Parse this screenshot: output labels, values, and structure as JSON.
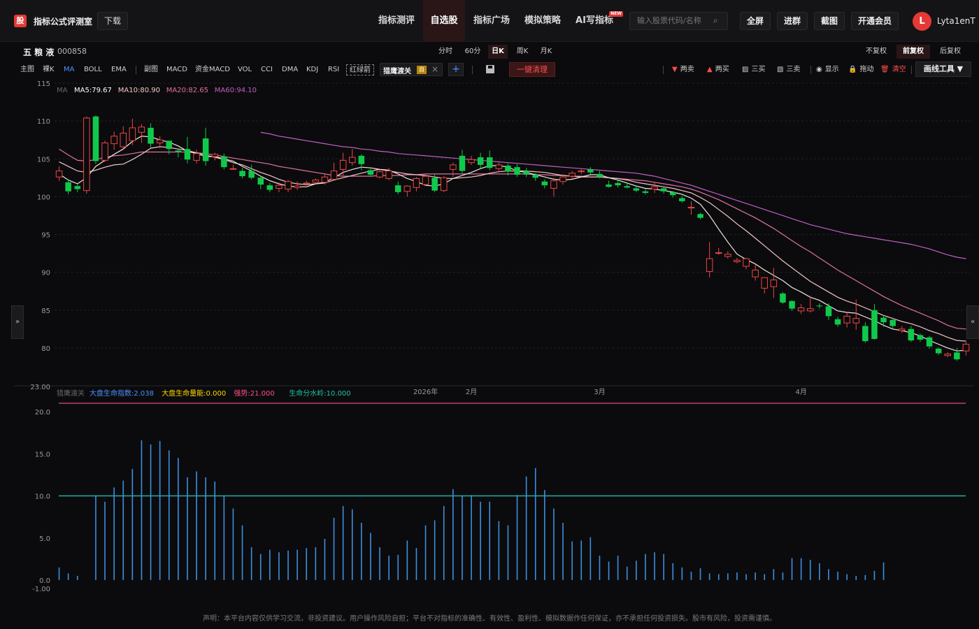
{
  "app": {
    "logo_glyph": "股",
    "brand": "指标公式评测室",
    "download_label": "下载"
  },
  "nav": {
    "items": [
      {
        "label": "指标测评",
        "active": false
      },
      {
        "label": "自选股",
        "active": true
      },
      {
        "label": "指标广场",
        "active": false
      },
      {
        "label": "模拟策略",
        "active": false
      },
      {
        "label": "AI写指标",
        "active": false,
        "badge": "NEW"
      }
    ]
  },
  "search": {
    "placeholder": "输入股票代码/名称",
    "icon": "search-icon"
  },
  "top_buttons": [
    "全屏",
    "进群",
    "截图",
    "开通会员"
  ],
  "user": {
    "avatar_letter": "L",
    "name": "Lyta1enT"
  },
  "stock": {
    "name": "五 粮 液",
    "code": "000858"
  },
  "periods": [
    {
      "label": "分时",
      "active": false
    },
    {
      "label": "60分",
      "active": false
    },
    {
      "label": "日K",
      "active": true
    },
    {
      "label": "周K",
      "active": false
    },
    {
      "label": "月K",
      "active": false
    }
  ],
  "rights": [
    {
      "label": "不复权",
      "active": false
    },
    {
      "label": "前复权",
      "active": true
    },
    {
      "label": "后复权",
      "active": false
    }
  ],
  "indicators_main": [
    "主图",
    "裸K",
    "MA",
    "BOLL",
    "EMA"
  ],
  "indicators_sub": [
    "副图",
    "MACD",
    "资金MACD",
    "VOL",
    "CCI",
    "DMA",
    "KDJ",
    "RSI",
    "红绿箭"
  ],
  "custom_indicator": {
    "label": "猎鹰渡关",
    "tag": "自"
  },
  "clear_label": "一键清理",
  "draw_tools": [
    {
      "icon": "▼",
      "label": "两卖",
      "color": "#ff4d4f"
    },
    {
      "icon": "▲",
      "label": "两买",
      "color": "#ff4d4f"
    },
    {
      "icon": "▨",
      "label": "三买",
      "color": "#cfcfcf"
    },
    {
      "icon": "▧",
      "label": "三卖",
      "color": "#cfcfcf"
    },
    {
      "icon": "◉",
      "label": "显示",
      "color": "#cfcfcf"
    },
    {
      "icon": "🔒",
      "label": "拖动",
      "color": "#cfcfcf"
    },
    {
      "icon": "🗑",
      "label": "清空",
      "color": "#ff4d4f"
    }
  ],
  "draw_menu_label": "画线工具 ▼",
  "side_handles": {
    "left": "»",
    "right": "«"
  },
  "ma_legend": {
    "prefix": "MA",
    "items": [
      {
        "label": "MA5:79.67",
        "color": "#ffffff"
      },
      {
        "label": "MA10:80.90",
        "color": "#f4c4c4"
      },
      {
        "label": "MA20:82.65",
        "color": "#e070a0"
      },
      {
        "label": "MA60:94.10",
        "color": "#c060c0"
      }
    ]
  },
  "sub_legend": {
    "prefix": "猎鹰渡关",
    "items": [
      {
        "label": "大盘生命指数:2.038",
        "color": "#4d8fff"
      },
      {
        "label": "大盘生命量能:0.000",
        "color": "#ffd700"
      },
      {
        "label": "强势:21.000",
        "color": "#ff4d88"
      },
      {
        "label": "生命分水岭:10.000",
        "color": "#20c0a0"
      }
    ]
  },
  "x_labels": [
    {
      "label": "2026年",
      "idx": 40
    },
    {
      "label": "2月",
      "idx": 45
    },
    {
      "label": "3月",
      "idx": 59
    },
    {
      "label": "4月",
      "idx": 81
    }
  ],
  "disclaimer": "声明：本平台内容仅供学习交流，非投资建议。用户操作风险自担；平台不对指标的准确性、有效性、盈利性、模拟数据作任何保证，亦不承担任何投资损失。股市有风险，投资需谨慎。",
  "chart_data": [
    {
      "type": "candlestick",
      "title": "五粮液 000858 日K 前复权",
      "ylim": [
        75,
        115
      ],
      "y_ticks": [
        80,
        85,
        90,
        95,
        100,
        105,
        110,
        115
      ],
      "candles": [
        [
          102.6,
          103.4,
          102.1,
          104.0
        ],
        [
          101.9,
          100.7,
          100.3,
          102.3
        ],
        [
          101.4,
          101.0,
          100.6,
          101.6
        ],
        [
          100.8,
          110.4,
          100.4,
          110.6
        ],
        [
          110.6,
          104.7,
          104.3,
          110.7
        ],
        [
          104.8,
          107.1,
          104.6,
          107.4
        ],
        [
          107.0,
          108.0,
          106.2,
          108.6
        ],
        [
          106.6,
          108.4,
          106.3,
          109.3
        ],
        [
          107.4,
          109.1,
          106.8,
          110.3
        ],
        [
          108.5,
          109.2,
          107.1,
          109.6
        ],
        [
          109.1,
          107.0,
          106.4,
          109.7
        ],
        [
          107.1,
          107.5,
          106.4,
          108.0
        ],
        [
          107.4,
          106.3,
          105.6,
          107.3
        ],
        [
          106.1,
          105.9,
          105.2,
          106.3
        ],
        [
          106.3,
          104.9,
          104.4,
          107.9
        ],
        [
          104.8,
          105.7,
          104.4,
          106.2
        ],
        [
          107.7,
          104.7,
          104.1,
          109.1
        ],
        [
          105.3,
          105.6,
          104.8,
          105.8
        ],
        [
          105.3,
          103.9,
          103.6,
          105.7
        ],
        [
          103.7,
          103.7,
          103.6,
          104.2
        ],
        [
          103.4,
          102.7,
          102.4,
          103.8
        ],
        [
          103.4,
          102.5,
          102.3,
          104.2
        ],
        [
          102.5,
          101.6,
          101.0,
          102.7
        ],
        [
          101.5,
          100.9,
          100.6,
          101.8
        ],
        [
          101.1,
          101.5,
          100.6,
          101.9
        ],
        [
          101.0,
          102.0,
          100.6,
          102.2
        ],
        [
          101.2,
          101.4,
          100.9,
          102.0
        ],
        [
          101.7,
          101.8,
          101.5,
          102.1
        ],
        [
          101.9,
          102.2,
          101.7,
          102.4
        ],
        [
          101.9,
          102.6,
          101.6,
          102.9
        ],
        [
          102.3,
          103.4,
          102.1,
          104.5
        ],
        [
          103.6,
          104.8,
          102.8,
          105.8
        ],
        [
          104.5,
          105.2,
          104.1,
          106.3
        ],
        [
          105.4,
          104.3,
          103.5,
          105.6
        ],
        [
          103.5,
          102.9,
          102.6,
          103.7
        ],
        [
          102.6,
          103.3,
          102.4,
          103.6
        ],
        [
          102.4,
          103.4,
          102.2,
          103.8
        ],
        [
          101.5,
          100.6,
          100.3,
          102.0
        ],
        [
          100.7,
          101.4,
          100.0,
          101.5
        ],
        [
          101.2,
          102.4,
          100.7,
          102.6
        ],
        [
          101.6,
          102.7,
          101.4,
          102.9
        ],
        [
          102.5,
          100.8,
          100.6,
          102.9
        ],
        [
          100.8,
          102.5,
          100.6,
          102.7
        ],
        [
          103.6,
          104.2,
          102.6,
          104.5
        ],
        [
          105.4,
          103.4,
          103.1,
          106.2
        ],
        [
          104.5,
          104.9,
          104.2,
          105.4
        ],
        [
          105.2,
          104.2,
          103.7,
          105.8
        ],
        [
          105.2,
          103.8,
          103.5,
          106.1
        ],
        [
          103.7,
          104.2,
          103.2,
          104.5
        ],
        [
          104.1,
          103.3,
          102.8,
          104.4
        ],
        [
          103.9,
          102.9,
          102.6,
          104.3
        ],
        [
          103.4,
          102.9,
          102.6,
          103.8
        ],
        [
          102.9,
          102.5,
          102.1,
          103.1
        ],
        [
          102.0,
          101.5,
          101.1,
          102.3
        ],
        [
          101.1,
          102.1,
          100.0,
          102.5
        ],
        [
          102.0,
          102.6,
          101.6,
          103.0
        ],
        [
          102.7,
          103.1,
          102.4,
          103.4
        ],
        [
          103.3,
          103.4,
          103.0,
          103.6
        ],
        [
          103.6,
          103.2,
          103.0,
          103.9
        ],
        [
          103.0,
          102.6,
          102.4,
          103.4
        ],
        [
          101.6,
          101.3,
          101.2,
          102.1
        ],
        [
          101.8,
          101.5,
          101.2,
          102.2
        ],
        [
          101.4,
          101.2,
          101.1,
          101.8
        ],
        [
          101.1,
          100.8,
          100.6,
          101.4
        ],
        [
          100.7,
          100.5,
          100.3,
          101.0
        ],
        [
          101.0,
          101.3,
          100.5,
          101.9
        ],
        [
          101.1,
          100.7,
          100.4,
          101.3
        ],
        [
          100.6,
          100.2,
          99.9,
          100.7
        ],
        [
          99.8,
          99.4,
          99.2,
          100.1
        ],
        [
          98.5,
          98.6,
          97.6,
          99.4
        ],
        [
          97.7,
          97.2,
          97.0,
          97.9
        ],
        [
          90.1,
          91.8,
          89.3,
          94.0
        ],
        [
          92.6,
          92.6,
          92.3,
          93.2
        ],
        [
          92.1,
          92.4,
          91.8,
          92.8
        ],
        [
          91.4,
          91.6,
          91.2,
          91.9
        ],
        [
          90.8,
          91.8,
          90.4,
          91.9
        ],
        [
          89.4,
          90.3,
          88.9,
          91.1
        ],
        [
          87.9,
          89.3,
          87.2,
          89.3
        ],
        [
          88.1,
          89.0,
          86.6,
          90.6
        ],
        [
          87.2,
          86.0,
          85.8,
          87.4
        ],
        [
          86.2,
          85.2,
          84.9,
          86.3
        ],
        [
          84.9,
          85.3,
          84.5,
          85.8
        ],
        [
          84.9,
          85.2,
          84.7,
          86.9
        ],
        [
          85.6,
          85.5,
          85.2,
          85.9
        ],
        [
          85.5,
          84.2,
          83.7,
          85.9
        ],
        [
          83.8,
          83.1,
          82.8,
          84.1
        ],
        [
          83.3,
          84.2,
          82.7,
          84.6
        ],
        [
          83.3,
          83.9,
          82.4,
          86.4
        ],
        [
          82.9,
          80.9,
          80.7,
          83.4
        ],
        [
          85.0,
          81.2,
          81.1,
          85.8
        ],
        [
          84.0,
          83.4,
          82.8,
          84.3
        ],
        [
          83.7,
          82.9,
          82.6,
          84.0
        ],
        [
          82.3,
          82.5,
          82.0,
          82.9
        ],
        [
          82.5,
          81.0,
          80.8,
          82.9
        ],
        [
          81.7,
          81.1,
          80.8,
          81.9
        ],
        [
          81.4,
          80.2,
          79.9,
          81.6
        ],
        [
          79.9,
          79.3,
          79.1,
          80.1
        ],
        [
          79.0,
          79.2,
          78.8,
          79.4
        ],
        [
          79.4,
          78.5,
          78.3,
          80.0
        ],
        [
          79.6,
          80.5,
          79.0,
          80.8
        ]
      ],
      "ma5": [
        103.0,
        102.2,
        101.7,
        102.5,
        104.0,
        104.8,
        105.6,
        106.3,
        107.3,
        108.0,
        107.9,
        107.5,
        107.2,
        106.7,
        106.0,
        105.7,
        105.3,
        105.3,
        105.0,
        104.7,
        104.0,
        103.4,
        102.7,
        102.1,
        101.7,
        101.4,
        101.3,
        101.3,
        101.7,
        101.9,
        102.5,
        103.2,
        103.6,
        103.9,
        103.8,
        103.6,
        103.5,
        103.0,
        102.4,
        102.0,
        101.5,
        101.4,
        101.7,
        102.4,
        102.8,
        103.2,
        103.7,
        104.1,
        104.1,
        103.9,
        103.4,
        103.2,
        102.9,
        102.6,
        102.3,
        102.2,
        102.3,
        102.6,
        102.9,
        102.9,
        102.5,
        102.2,
        101.8,
        101.4,
        101.1,
        101.0,
        100.8,
        100.6,
        100.3,
        99.8,
        99.0,
        97.5,
        95.7,
        94.0,
        92.4,
        91.7,
        91.1,
        90.3,
        89.6,
        88.9,
        88.0,
        87.4,
        86.7,
        86.3,
        85.6,
        84.9,
        84.7,
        84.6,
        84.1,
        83.6,
        83.0,
        82.5,
        82.3,
        82.0,
        81.6,
        81.0,
        80.5,
        80.0,
        79.6,
        79.7
      ],
      "ma10": [
        104.6,
        104.0,
        103.4,
        103.2,
        103.5,
        103.9,
        104.2,
        104.3,
        104.9,
        105.6,
        106.4,
        106.6,
        106.5,
        106.3,
        106.1,
        105.8,
        105.5,
        105.2,
        104.9,
        104.5,
        104.2,
        103.7,
        103.2,
        102.8,
        102.3,
        101.9,
        101.7,
        101.6,
        101.7,
        101.8,
        102.2,
        102.5,
        102.8,
        103.1,
        103.4,
        103.6,
        103.4,
        103.2,
        103.0,
        102.9,
        102.8,
        102.6,
        102.4,
        102.4,
        102.5,
        102.6,
        102.8,
        103.1,
        103.3,
        103.4,
        103.4,
        103.4,
        103.3,
        103.2,
        103.0,
        102.8,
        102.7,
        102.6,
        102.6,
        102.6,
        102.5,
        102.4,
        102.2,
        101.9,
        101.7,
        101.5,
        101.3,
        101.1,
        100.8,
        100.5,
        99.9,
        99.2,
        98.3,
        97.4,
        96.4,
        95.5,
        94.5,
        93.5,
        92.5,
        91.5,
        90.6,
        89.7,
        88.8,
        88.1,
        87.4,
        86.7,
        86.2,
        85.8,
        85.3,
        84.8,
        84.3,
        83.9,
        83.5,
        83.2,
        82.8,
        82.3,
        81.9,
        81.4,
        81.0,
        80.9
      ],
      "ma20": [
        106.3,
        105.5,
        104.8,
        104.7,
        104.9,
        105.2,
        105.4,
        105.5,
        105.7,
        105.9,
        105.9,
        105.9,
        105.9,
        105.9,
        105.9,
        105.8,
        105.7,
        105.5,
        105.3,
        105.1,
        104.9,
        104.7,
        104.5,
        104.3,
        104.0,
        103.8,
        103.6,
        103.4,
        103.2,
        103.0,
        102.8,
        102.7,
        102.7,
        102.7,
        102.7,
        102.8,
        102.8,
        102.8,
        102.9,
        102.9,
        103.0,
        103.0,
        103.0,
        103.0,
        103.0,
        103.0,
        103.0,
        103.0,
        103.0,
        103.0,
        103.0,
        103.0,
        102.9,
        102.9,
        102.8,
        102.8,
        102.7,
        102.7,
        102.6,
        102.6,
        102.5,
        102.4,
        102.3,
        102.2,
        102.1,
        101.9,
        101.7,
        101.5,
        101.3,
        101.0,
        100.6,
        100.1,
        99.6,
        99.0,
        98.4,
        97.8,
        97.2,
        96.5,
        95.8,
        95.0,
        94.2,
        93.4,
        92.7,
        91.9,
        91.1,
        90.3,
        89.6,
        88.9,
        88.2,
        87.5,
        86.8,
        86.2,
        85.6,
        85.1,
        84.6,
        84.1,
        83.6,
        83.0,
        82.6,
        82.5
      ],
      "ma60": [
        null,
        null,
        null,
        null,
        null,
        null,
        null,
        null,
        null,
        null,
        null,
        null,
        null,
        null,
        null,
        null,
        null,
        null,
        null,
        null,
        null,
        null,
        108.5,
        108.3,
        108.0,
        107.8,
        107.6,
        107.4,
        107.2,
        107.0,
        106.8,
        106.6,
        106.5,
        106.3,
        106.2,
        106.0,
        105.9,
        105.7,
        105.6,
        105.5,
        105.4,
        105.3,
        105.2,
        105.1,
        105.0,
        104.9,
        104.8,
        104.7,
        104.6,
        104.5,
        104.4,
        104.3,
        104.2,
        104.1,
        104.0,
        103.9,
        103.8,
        103.7,
        103.6,
        103.5,
        103.4,
        103.3,
        103.2,
        103.1,
        102.9,
        102.7,
        102.4,
        102.1,
        101.8,
        101.5,
        101.1,
        100.7,
        100.3,
        99.9,
        99.5,
        99.1,
        98.7,
        98.3,
        97.9,
        97.5,
        97.1,
        96.7,
        96.3,
        96.0,
        95.7,
        95.4,
        95.1,
        94.9,
        94.7,
        94.5,
        94.3,
        94.1,
        93.9,
        93.7,
        93.4,
        93.1,
        92.7,
        92.3,
        92.0,
        91.8
      ]
    },
    {
      "type": "bar",
      "title": "猎鹰渡关",
      "ylim": [
        -1,
        23
      ],
      "y_ticks": [
        -1.0,
        0.0,
        5.0,
        10.0,
        15.0,
        20.0,
        23.0
      ],
      "threshold": 10.0,
      "strong_line": 21.0,
      "values": [
        1.5,
        0.8,
        0.5,
        0,
        10.0,
        9.3,
        11.0,
        11.8,
        13.2,
        16.6,
        16.1,
        16.5,
        15.4,
        14.5,
        12.2,
        12.9,
        12.2,
        11.7,
        10.0,
        8.5,
        6.5,
        3.9,
        3.1,
        3.6,
        3.3,
        3.5,
        3.6,
        3.8,
        3.9,
        4.9,
        7.4,
        8.8,
        8.4,
        6.8,
        5.6,
        3.9,
        2.9,
        3.0,
        4.7,
        3.8,
        6.5,
        7.1,
        8.8,
        10.8,
        10.0,
        10.1,
        9.3,
        9.3,
        7.0,
        6.5,
        10.1,
        12.3,
        13.3,
        10.7,
        8.5,
        6.8,
        4.6,
        4.7,
        5.1,
        2.9,
        2.2,
        2.9,
        1.6,
        2.3,
        3.1,
        3.3,
        3.1,
        2.0,
        1.5,
        1.0,
        1.4,
        0.8,
        0.7,
        0.8,
        0.9,
        0.7,
        0.9,
        0.7,
        1.3,
        0.9,
        2.6,
        2.6,
        2.4,
        2.0,
        1.3,
        1.0,
        0.7,
        0.5,
        0.6,
        1.1,
        2.1
      ]
    }
  ]
}
